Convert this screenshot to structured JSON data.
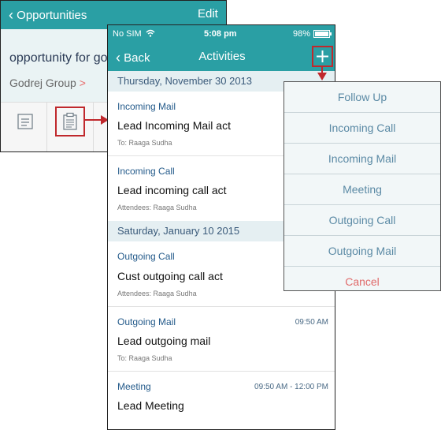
{
  "back_screen": {
    "back_label": "Opportunities",
    "edit_label": "Edit",
    "title": "opportunity for go",
    "company": "Godrej Group",
    "company_chevron": ">"
  },
  "status_bar": {
    "carrier": "No SIM",
    "time": "5:08 pm",
    "battery": "98%"
  },
  "nav": {
    "back_label": "Back",
    "title": "Activities",
    "add_glyph": "+"
  },
  "sections": [
    {
      "date": "Thursday, November 30 2013",
      "items": [
        {
          "type": "Incoming Mail",
          "subject": "Lead Incoming Mail act",
          "meta": "To: Raaga Sudha",
          "time": ""
        },
        {
          "type": "Incoming Call",
          "subject": "Lead incoming call act",
          "meta": "Attendees: Raaga Sudha",
          "time": ""
        }
      ]
    },
    {
      "date": "Saturday, January 10 2015",
      "items": [
        {
          "type": "Outgoing Call",
          "subject": "Cust outgoing call act",
          "meta": "Attendees: Raaga Sudha",
          "time": ""
        },
        {
          "type": "Outgoing Mail",
          "subject": "Lead outgoing mail",
          "meta": "To: Raaga Sudha",
          "time": "09:50 AM"
        },
        {
          "type": "Meeting",
          "subject": "Lead Meeting",
          "meta": "",
          "time": "09:50 AM - 12:00 PM"
        }
      ]
    }
  ],
  "action_sheet": {
    "items": [
      "Follow Up",
      "Incoming Call",
      "Incoming Mail",
      "Meeting",
      "Outgoing Call",
      "Outgoing Mail"
    ],
    "cancel_label": "Cancel"
  },
  "colors": {
    "teal": "#2a9fa4",
    "highlight_red": "#c0282c",
    "section_bg": "#e5eff2",
    "link_blue": "#235a8a",
    "cancel_red": "#e06a6a"
  },
  "icons": {
    "notes_tab": "notes-icon",
    "activities_tab": "clipboard-icon",
    "wifi": "wifi-icon",
    "battery": "battery-icon",
    "back": "chevron-left-icon",
    "add": "plus-icon"
  }
}
